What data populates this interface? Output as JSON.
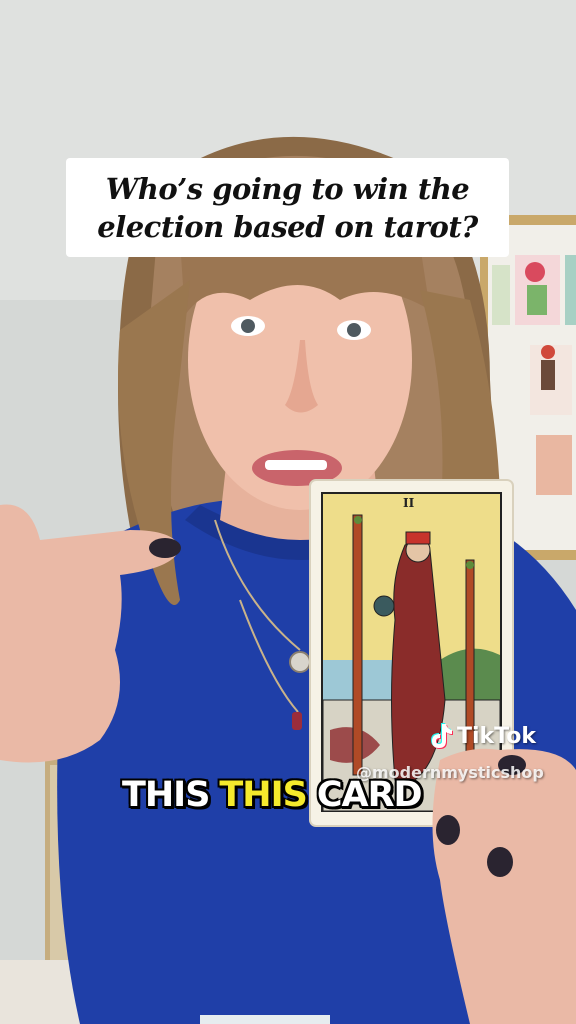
{
  "caption": {
    "line1": "Who’s going to win the",
    "line2": "election based on tarot?"
  },
  "card": {
    "numeral": "II"
  },
  "subtitle": {
    "word1": "THIS",
    "word2": "THIS",
    "word3": "CARD",
    "highlight_color": "#f5ea2c"
  },
  "watermark": {
    "brand": "TikTok",
    "handle": "@modernmysticshop",
    "icon": "tiktok-logo-icon"
  },
  "colors": {
    "shirt": "#1f3fa8",
    "wall": "#d9dbd8"
  }
}
